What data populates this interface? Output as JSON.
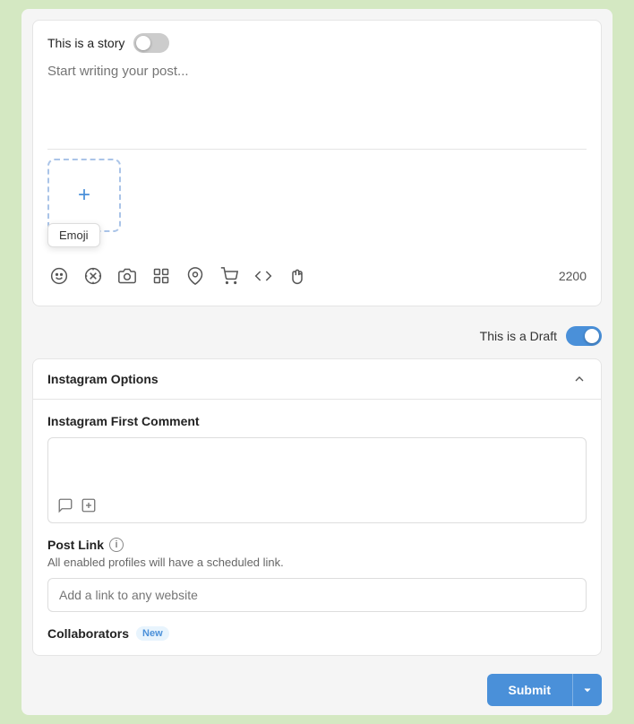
{
  "story": {
    "label": "This is a story",
    "toggle_state": "off"
  },
  "post": {
    "placeholder": "Start writing your post...",
    "char_count": "2200"
  },
  "media_upload": {
    "label": "Add media"
  },
  "emoji_tooltip": {
    "label": "Emoji"
  },
  "toolbar": {
    "icons": [
      "emoji",
      "giphy",
      "camera",
      "media",
      "location",
      "product",
      "code",
      "hand"
    ]
  },
  "draft": {
    "label": "This is a Draft",
    "toggle_state": "on"
  },
  "instagram_options": {
    "title": "Instagram Options",
    "expanded": true,
    "collapse_label": "collapse"
  },
  "first_comment": {
    "label": "Instagram First Comment",
    "placeholder": ""
  },
  "post_link": {
    "label": "Post Link",
    "description": "All enabled profiles will have a scheduled link.",
    "placeholder": "Add a link to any website"
  },
  "collaborators": {
    "label": "Collaborators",
    "badge": "New"
  },
  "submit": {
    "label": "Submit",
    "dropdown_label": "▼"
  }
}
